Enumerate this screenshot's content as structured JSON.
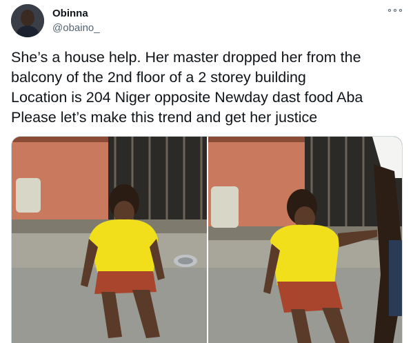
{
  "tweet": {
    "author": {
      "display_name": "Obinna",
      "handle": "@obaino_"
    },
    "text_lines": [
      "She’s a house help. Her master dropped her from the",
      "balcony of the 2nd floor of a 2 storey building",
      "Location is 204 Niger opposite Newday dast food Aba",
      "Please let’s make this trend and get her justice"
    ],
    "menu_icon": "more-horizontal-icon"
  },
  "media": {
    "count": 2,
    "colors": {
      "wall": "#c97a5e",
      "shirt": "#f2df1b",
      "shorts": "#a8452c",
      "skin": "#5a3a28",
      "ground": "#9a9a94"
    }
  }
}
